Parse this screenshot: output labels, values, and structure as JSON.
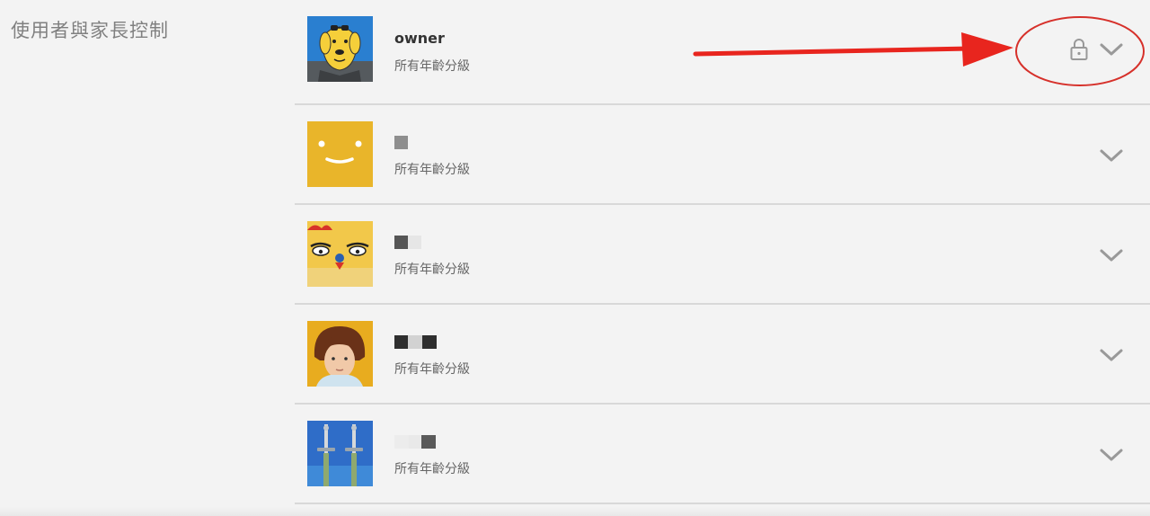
{
  "section": {
    "title": "使用者與家長控制"
  },
  "profiles": [
    {
      "name": "owner",
      "maturity": "所有年齡分級",
      "avatar_icon": "yellow-dog-avatar-icon",
      "locked": true
    },
    {
      "name": "",
      "maturity": "所有年齡分級",
      "avatar_icon": "yellow-smiley-avatar-icon",
      "locked": false
    },
    {
      "name": "",
      "maturity": "所有年齡分級",
      "avatar_icon": "yellow-chicken-avatar-icon",
      "locked": false
    },
    {
      "name": "",
      "maturity": "所有年齡分級",
      "avatar_icon": "boy-portrait-avatar-icon",
      "locked": false
    },
    {
      "name": "",
      "maturity": "所有年齡分級",
      "avatar_icon": "swords-avatar-icon",
      "locked": false
    }
  ],
  "colors": {
    "background": "#f3f3f3",
    "annotation_red": "#e8251e",
    "divider": "#d8d8d8",
    "icon_gray": "#999999"
  }
}
